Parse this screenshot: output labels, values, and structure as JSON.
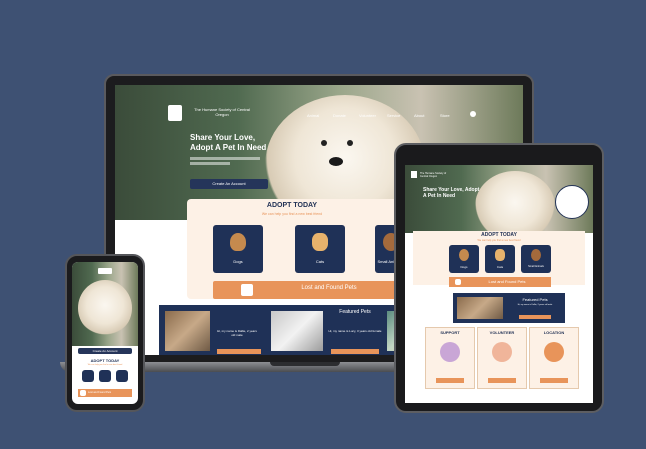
{
  "site": {
    "org_name": "The Humane Society of Central Oregon",
    "nav": [
      "Animal",
      "Donate",
      "Volunteer",
      "Service",
      "About",
      "Store"
    ],
    "hero_title": "Share Your Love, Adopt A Pet In Need",
    "hero_title_line1": "Share Your Love,",
    "hero_title_line2": "Adopt A Pet In Need",
    "create_account": "Create An Account",
    "adopt_title": "ADOPT TODAY",
    "adopt_subtitle": "We can help you find a new best friend",
    "pets": [
      {
        "label": "Dogs",
        "icon": "dog-icon"
      },
      {
        "label": "Cats",
        "icon": "cat-icon"
      },
      {
        "label": "Small Animals",
        "icon": "small-animal-icon"
      }
    ],
    "lost_found": "Lost and Found Pets",
    "featured_title": "Featured Pets",
    "featured_cards": [
      "Hi, my name is Dallie, 2 years old male",
      "Hi, my name is Lucy, 3 years old female"
    ],
    "info_columns": [
      "SUPPORT",
      "VOLUNTEER",
      "LOCATION"
    ]
  },
  "colors": {
    "background": "#3e5173",
    "navy": "#1f3157",
    "orange": "#e8945a",
    "peach": "#fdf1e6"
  }
}
